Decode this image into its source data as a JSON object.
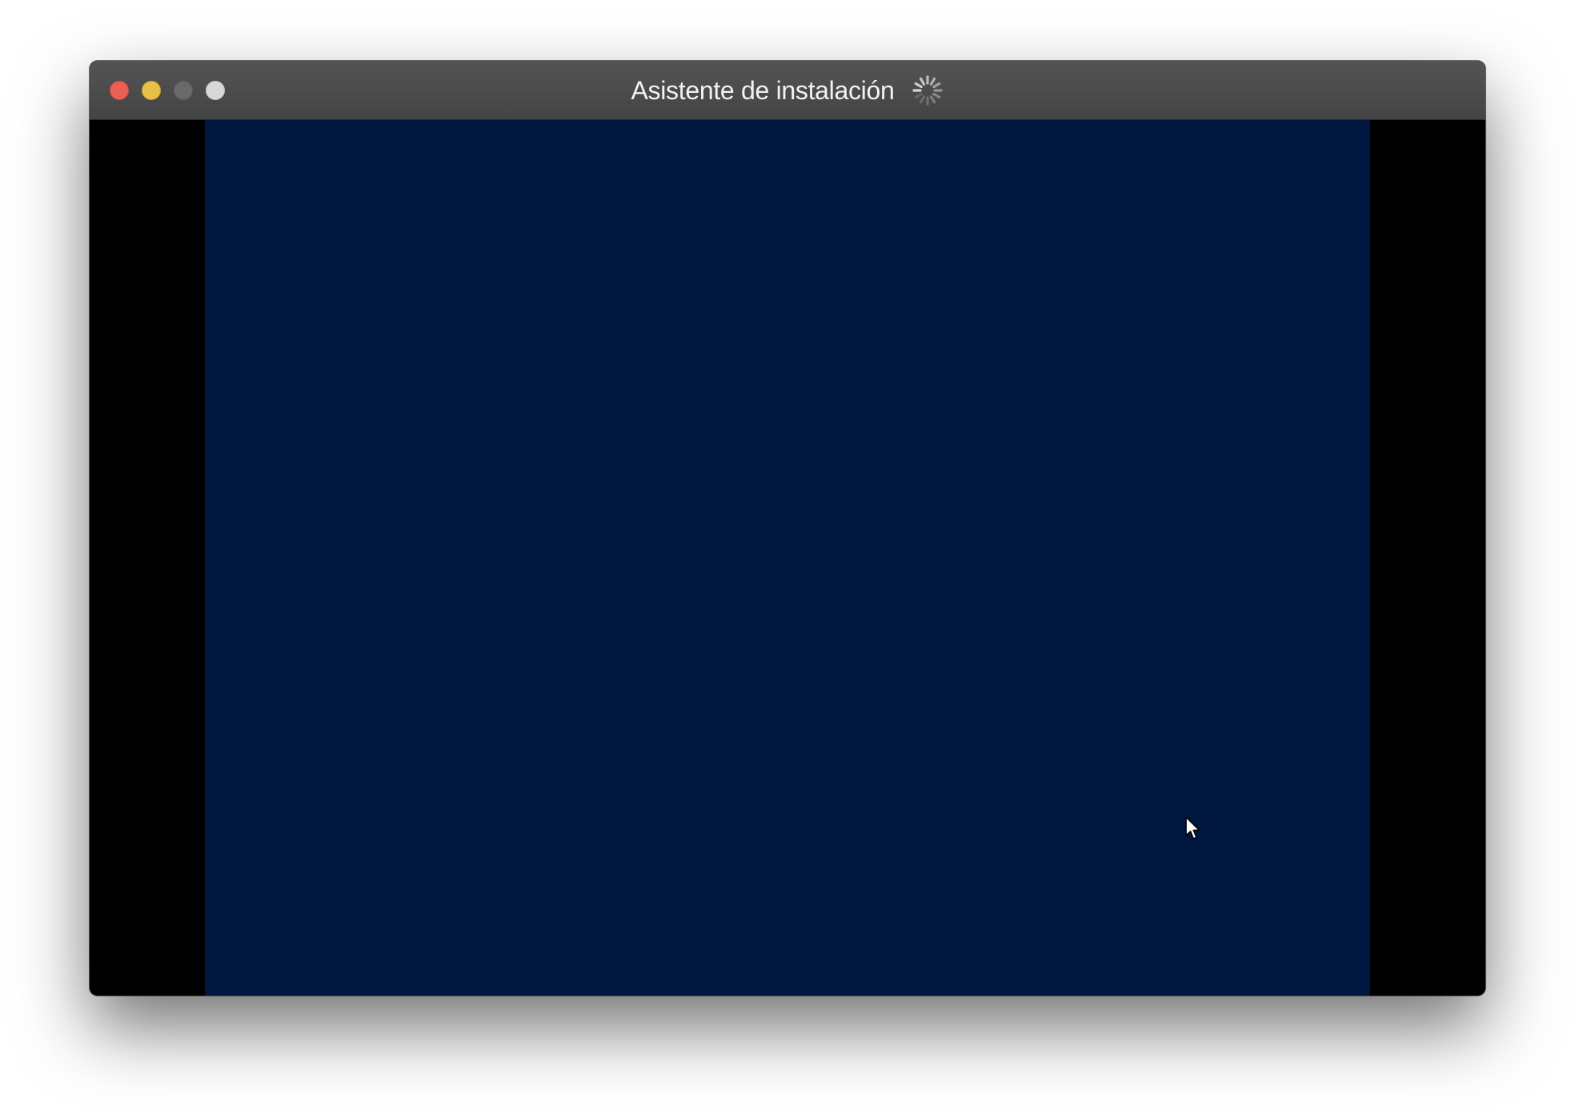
{
  "window": {
    "title": "Asistente de instalación",
    "controls": {
      "close_color": "#ec5f57",
      "minimize_color": "#e8bf47",
      "zoom_color": "#6a6a6a",
      "extra_color": "#d8d8d8"
    },
    "loading_indicator": "spinner-icon"
  },
  "vm_display": {
    "background_color": "#001840",
    "letterbox_color": "#000000",
    "pointer": "mouse-pointer-icon"
  }
}
